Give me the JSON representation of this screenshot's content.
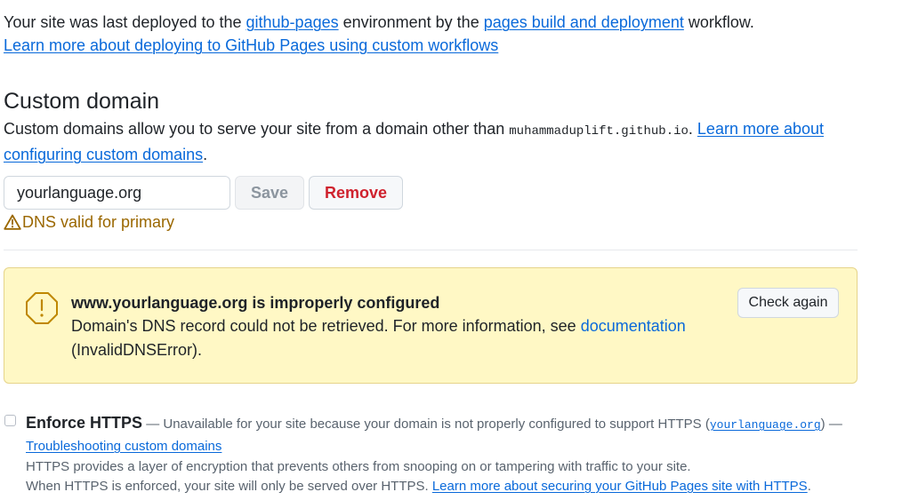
{
  "deploy": {
    "text_before": "Your site was last deployed to the ",
    "environment_link": "github-pages",
    "text_middle": " environment by the ",
    "workflow_link": "pages build and deployment",
    "text_after": " workflow.",
    "learn_link": "Learn more about deploying to GitHub Pages using custom workflows"
  },
  "custom_domain": {
    "heading": "Custom domain",
    "desc_before": "Custom domains allow you to serve your site from a domain other than ",
    "default_domain": "muhammaduplift.github.io",
    "desc_period": ". ",
    "learn_link": "Learn more about configuring custom domains",
    "desc_end": ".",
    "input_value": "yourlanguage.org",
    "save_label": "Save",
    "remove_label": "Remove",
    "dns_status": "DNS valid for primary"
  },
  "warning": {
    "title": "www.yourlanguage.org is improperly configured",
    "body_before": "Domain's DNS record could not be retrieved. For more information, see ",
    "doc_link": "documentation",
    "body_after": "(InvalidDNSError).",
    "check_label": "Check again",
    "icon": "alert-icon"
  },
  "https": {
    "title": "Enforce HTTPS",
    "desc_before": " — Unavailable for your site because your domain is not properly configured to support HTTPS (",
    "domain_link": "yourlanguage.org",
    "desc_after": ") —",
    "trouble_link": "Troubleshooting custom domains",
    "note1": "HTTPS provides a layer of encryption that prevents others from snooping on or tampering with traffic to your site.",
    "note2_before": "When HTTPS is enforced, your site will only be served over HTTPS. ",
    "secure_link": "Learn more about securing your GitHub Pages site with HTTPS",
    "note2_after": "."
  },
  "colors": {
    "link": "#0969da",
    "warning_bg": "#fff8c5",
    "warning_text": "#9a6700",
    "danger": "#cf222e"
  }
}
